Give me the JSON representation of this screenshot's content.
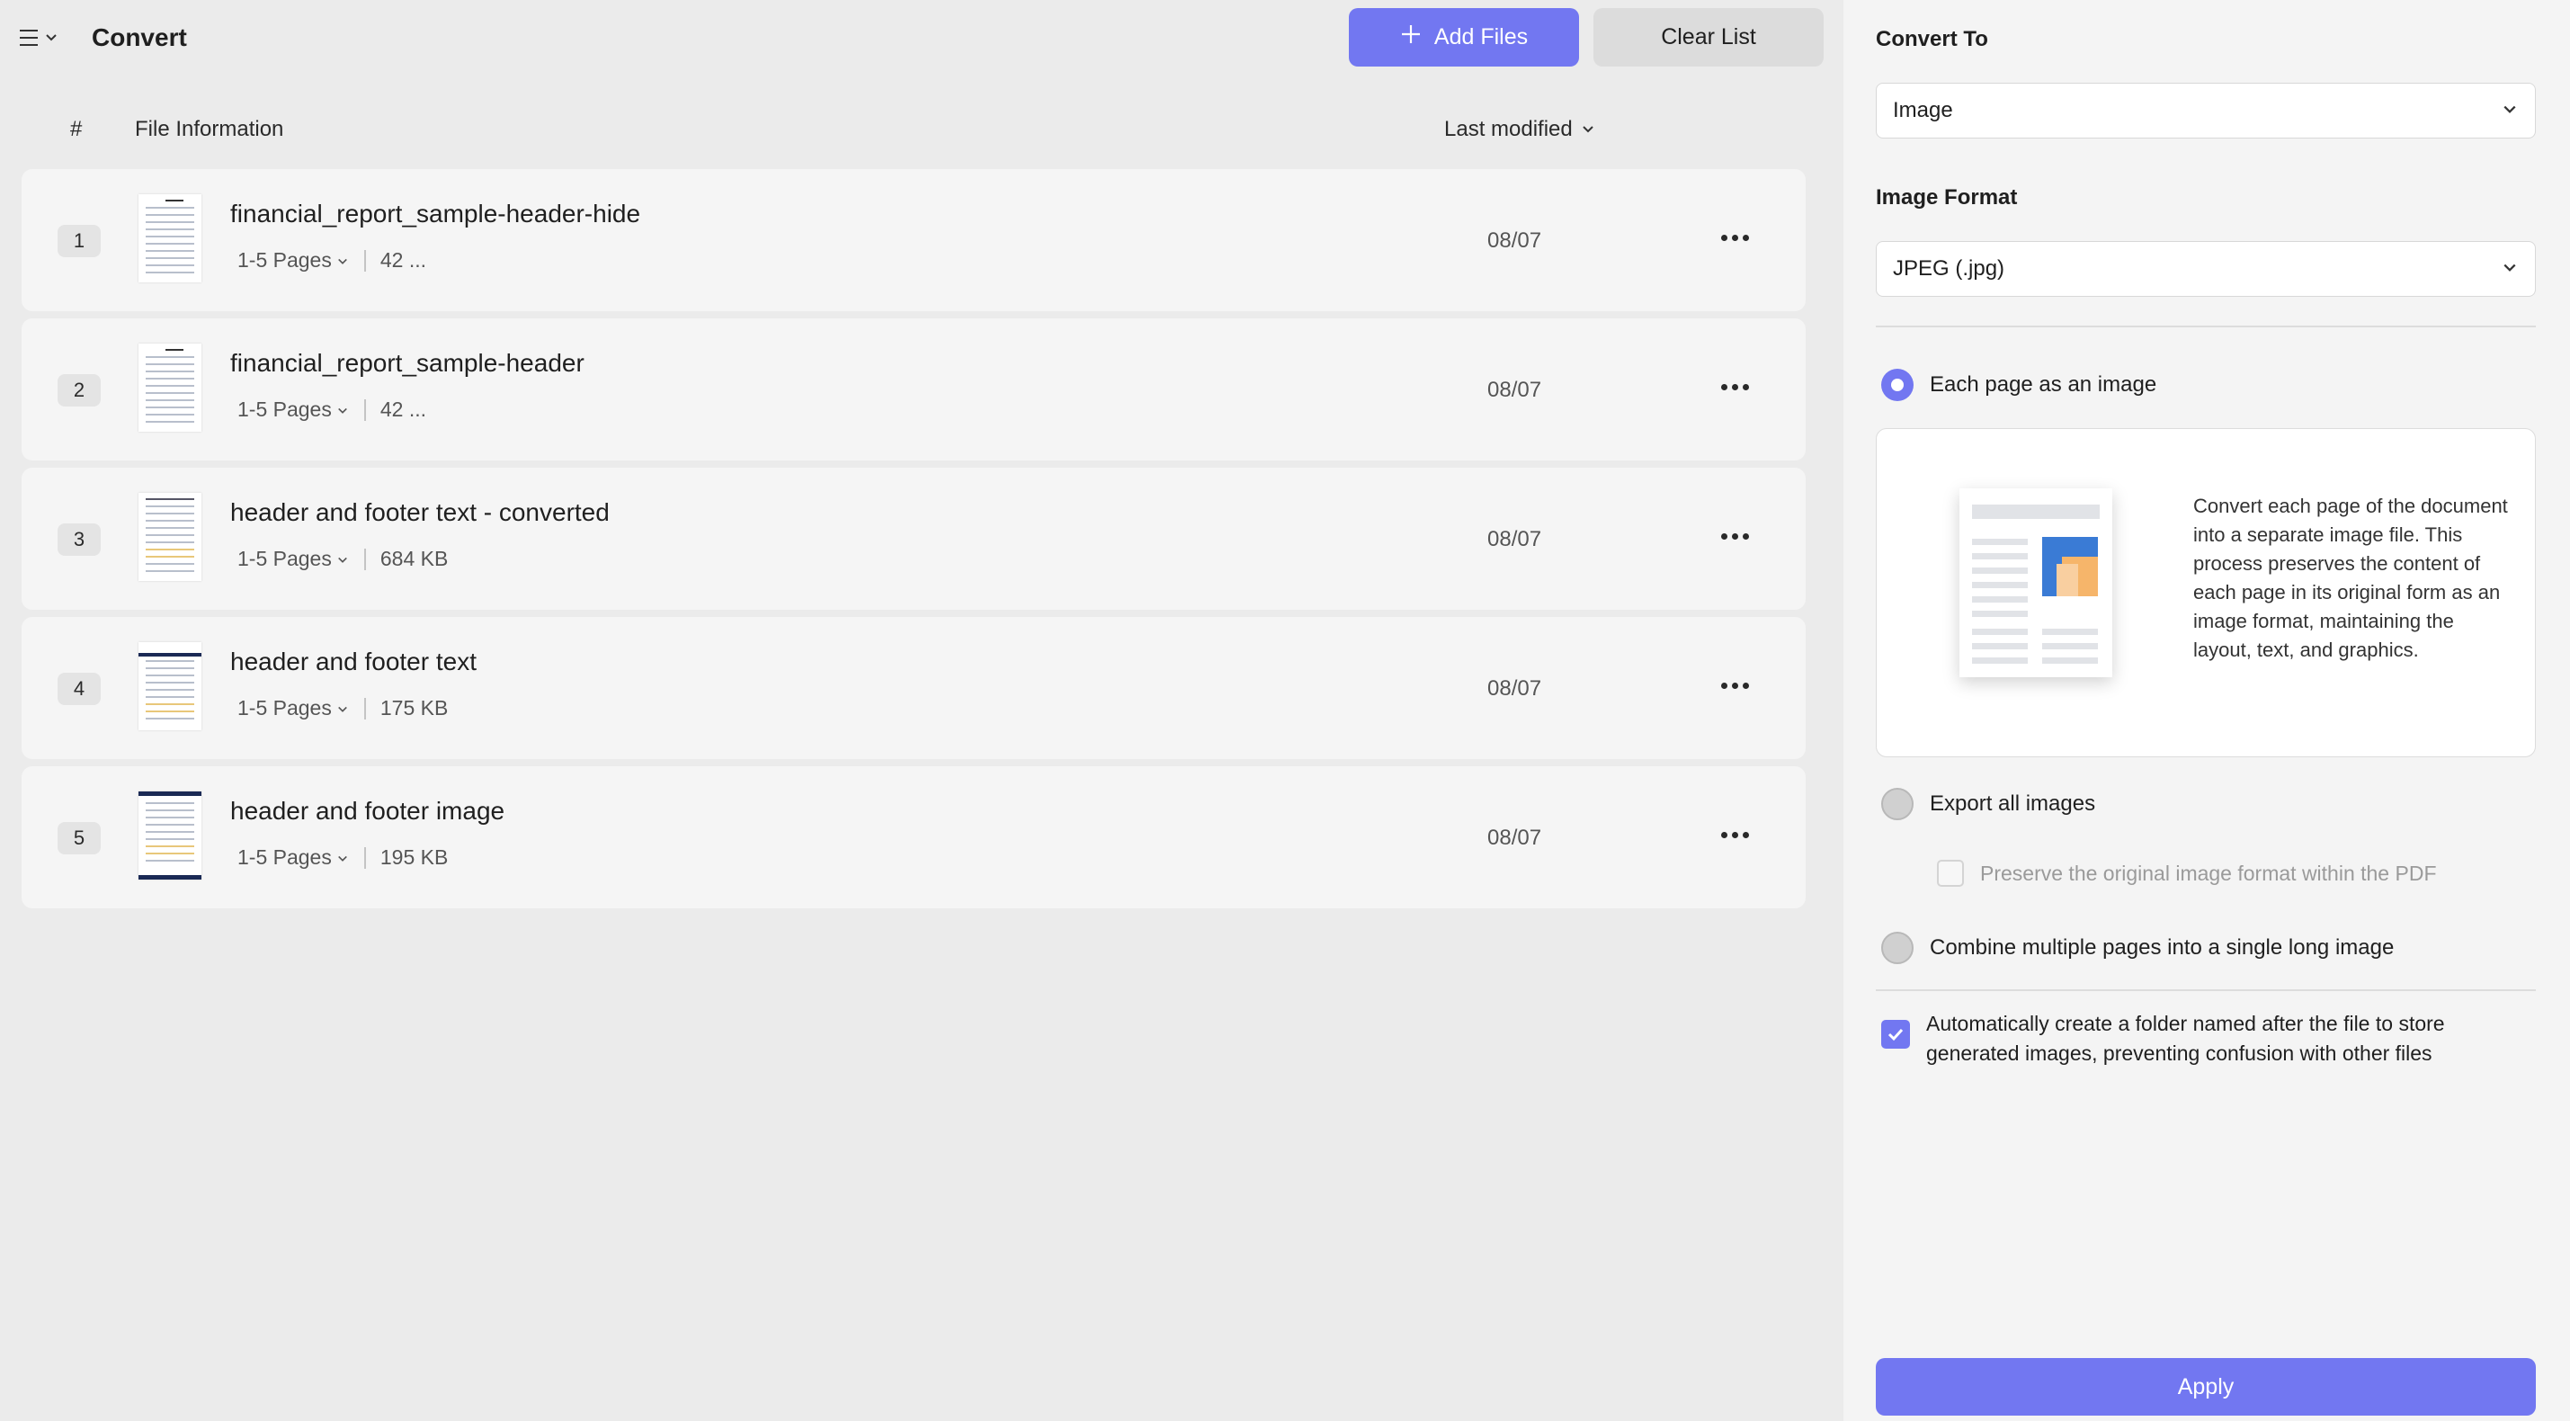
{
  "header": {
    "title": "Convert",
    "add_files_label": "Add Files",
    "clear_list_label": "Clear List"
  },
  "columns": {
    "num": "#",
    "info": "File Information",
    "modified": "Last modified"
  },
  "files": [
    {
      "num": "1",
      "name": "financial_report_sample-header-hide",
      "pages": "1-5 Pages",
      "size": "42 ...",
      "date": "08/07"
    },
    {
      "num": "2",
      "name": "financial_report_sample-header",
      "pages": "1-5 Pages",
      "size": "42 ...",
      "date": "08/07"
    },
    {
      "num": "3",
      "name": "header and footer text - converted",
      "pages": "1-5 Pages",
      "size": "684 KB",
      "date": "08/07"
    },
    {
      "num": "4",
      "name": "header and footer text",
      "pages": "1-5 Pages",
      "size": "175 KB",
      "date": "08/07"
    },
    {
      "num": "5",
      "name": "header and footer image",
      "pages": "1-5 Pages",
      "size": "195 KB",
      "date": "08/07"
    }
  ],
  "panel": {
    "convert_to_label": "Convert To",
    "convert_to_value": "Image",
    "image_format_label": "Image Format",
    "image_format_value": "JPEG (.jpg)",
    "option_each_page": "Each page as an image",
    "option_each_page_desc": "Convert each page of the document into a separate image file. This process preserves the content of each page in its original form as an image format, maintaining the layout, text, and graphics.",
    "option_export_images": "Export all images",
    "preserve_format": "Preserve the original image format within the PDF",
    "option_combine": "Combine multiple pages into a single long image",
    "auto_folder": "Automatically create a folder named after the file to store generated images, preventing confusion with other files",
    "apply_label": "Apply"
  },
  "colors": {
    "accent": "#7277f1",
    "background": "#ebebeb",
    "panel": "#f4f4f4"
  },
  "icons": [
    "menu-icon",
    "chevron-down-icon",
    "plus-icon",
    "more-icon",
    "check-icon"
  ]
}
